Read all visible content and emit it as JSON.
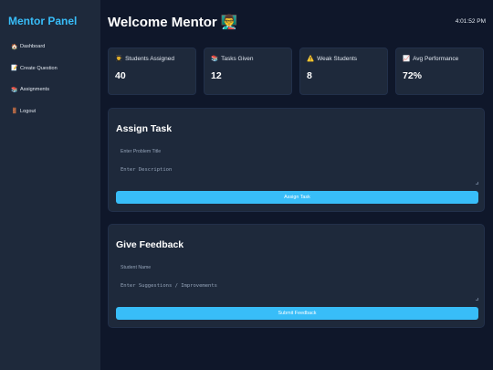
{
  "sidebar": {
    "brand": "Mentor Panel",
    "items": [
      {
        "icon": "🏠",
        "label": "Dashboard"
      },
      {
        "icon": "📝",
        "label": "Create Question"
      },
      {
        "icon": "📚",
        "label": "Assignments"
      },
      {
        "icon": "🚪",
        "label": "Logout"
      }
    ]
  },
  "header": {
    "title": "Welcome Mentor 👨‍🏫",
    "clock": "4:01:52 PM"
  },
  "stats": [
    {
      "icon": "👨‍🎓",
      "label": "Students Assigned",
      "value": "40"
    },
    {
      "icon": "📚",
      "label": "Tasks Given",
      "value": "12"
    },
    {
      "icon": "⚠️",
      "label": "Weak Students",
      "value": "8"
    },
    {
      "icon": "📈",
      "label": "Avg Performance",
      "value": "72%"
    }
  ],
  "assign": {
    "title": "Assign Task",
    "title_placeholder": "Enter Problem Title",
    "desc_placeholder": "Enter Description",
    "button": "Assign Task"
  },
  "feedback": {
    "title": "Give Feedback",
    "name_placeholder": "Student Name",
    "text_placeholder": "Enter Suggestions / Improvements",
    "button": "Submit Feedback"
  },
  "colors": {
    "accent": "#38bdf8",
    "background": "#0f172a",
    "card": "#1e293b"
  }
}
